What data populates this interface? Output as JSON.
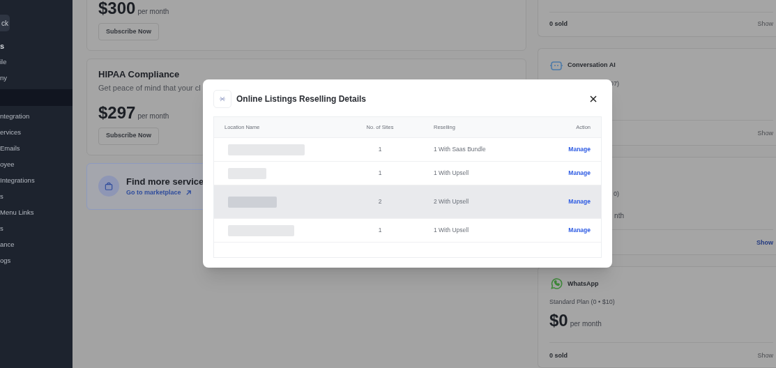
{
  "sidebar": {
    "items": [
      {
        "label": "ck",
        "kind": "button"
      },
      {
        "label": "s",
        "kind": "heading"
      },
      {
        "label": "ile",
        "kind": "link"
      },
      {
        "label": "ny",
        "kind": "link"
      },
      {
        "kind": "active"
      },
      {
        "label": "ntegration",
        "kind": "link"
      },
      {
        "label": "ervices",
        "kind": "link"
      },
      {
        "label": "Emails",
        "kind": "link"
      },
      {
        "label": "oyee",
        "kind": "link"
      },
      {
        "label": "Integrations",
        "kind": "link"
      },
      {
        "label": "s",
        "kind": "link"
      },
      {
        "label": "Menu Links",
        "kind": "link"
      },
      {
        "label": "s",
        "kind": "link"
      },
      {
        "label": "ance",
        "kind": "link"
      },
      {
        "label": "ogs",
        "kind": "link"
      }
    ]
  },
  "left_cards": [
    {
      "kind": "plan",
      "price": "$300",
      "period": "per month",
      "button": "Subscribe Now"
    },
    {
      "kind": "plan",
      "title": "HIPAA Compliance",
      "description": "Get peace of mind that your cl",
      "price": "$297",
      "period": "per month",
      "button": "Subscribe Now"
    },
    {
      "kind": "promo",
      "title": "Find more service",
      "link": "Go to marketplace"
    }
  ],
  "right_cards": [
    {
      "kind": "partial",
      "footer": "0 sold",
      "show": "Show",
      "show_active": false
    },
    {
      "kind": "ai",
      "title": "Conversation AI",
      "plan": "97)",
      "show": "Show",
      "show_active": false
    },
    {
      "kind": "hidden",
      "plan": "0)",
      "price": "nth",
      "show": "Show",
      "show_active": true
    },
    {
      "kind": "whatsapp",
      "title": "WhatsApp",
      "plan": "Standard Plan (0 • $10)",
      "price": "$0",
      "period": "per month",
      "footer": "0 sold",
      "show": "Show",
      "show_active": false
    }
  ],
  "modal": {
    "title": "Online Listings Reselling Details",
    "columns": [
      "Location Name",
      "No. of Sites",
      "Reselling",
      "Action"
    ],
    "rows": [
      {
        "sites": "1",
        "reselling": "1 With Saas Bundle",
        "action": "Manage",
        "selected": false
      },
      {
        "sites": "1",
        "reselling": "1 With Upsell",
        "action": "Manage",
        "selected": false
      },
      {
        "sites": "2",
        "reselling": "2 With Upsell",
        "action": "Manage",
        "selected": true
      },
      {
        "sites": "1",
        "reselling": "1 With Upsell",
        "action": "Manage",
        "selected": false
      }
    ]
  }
}
